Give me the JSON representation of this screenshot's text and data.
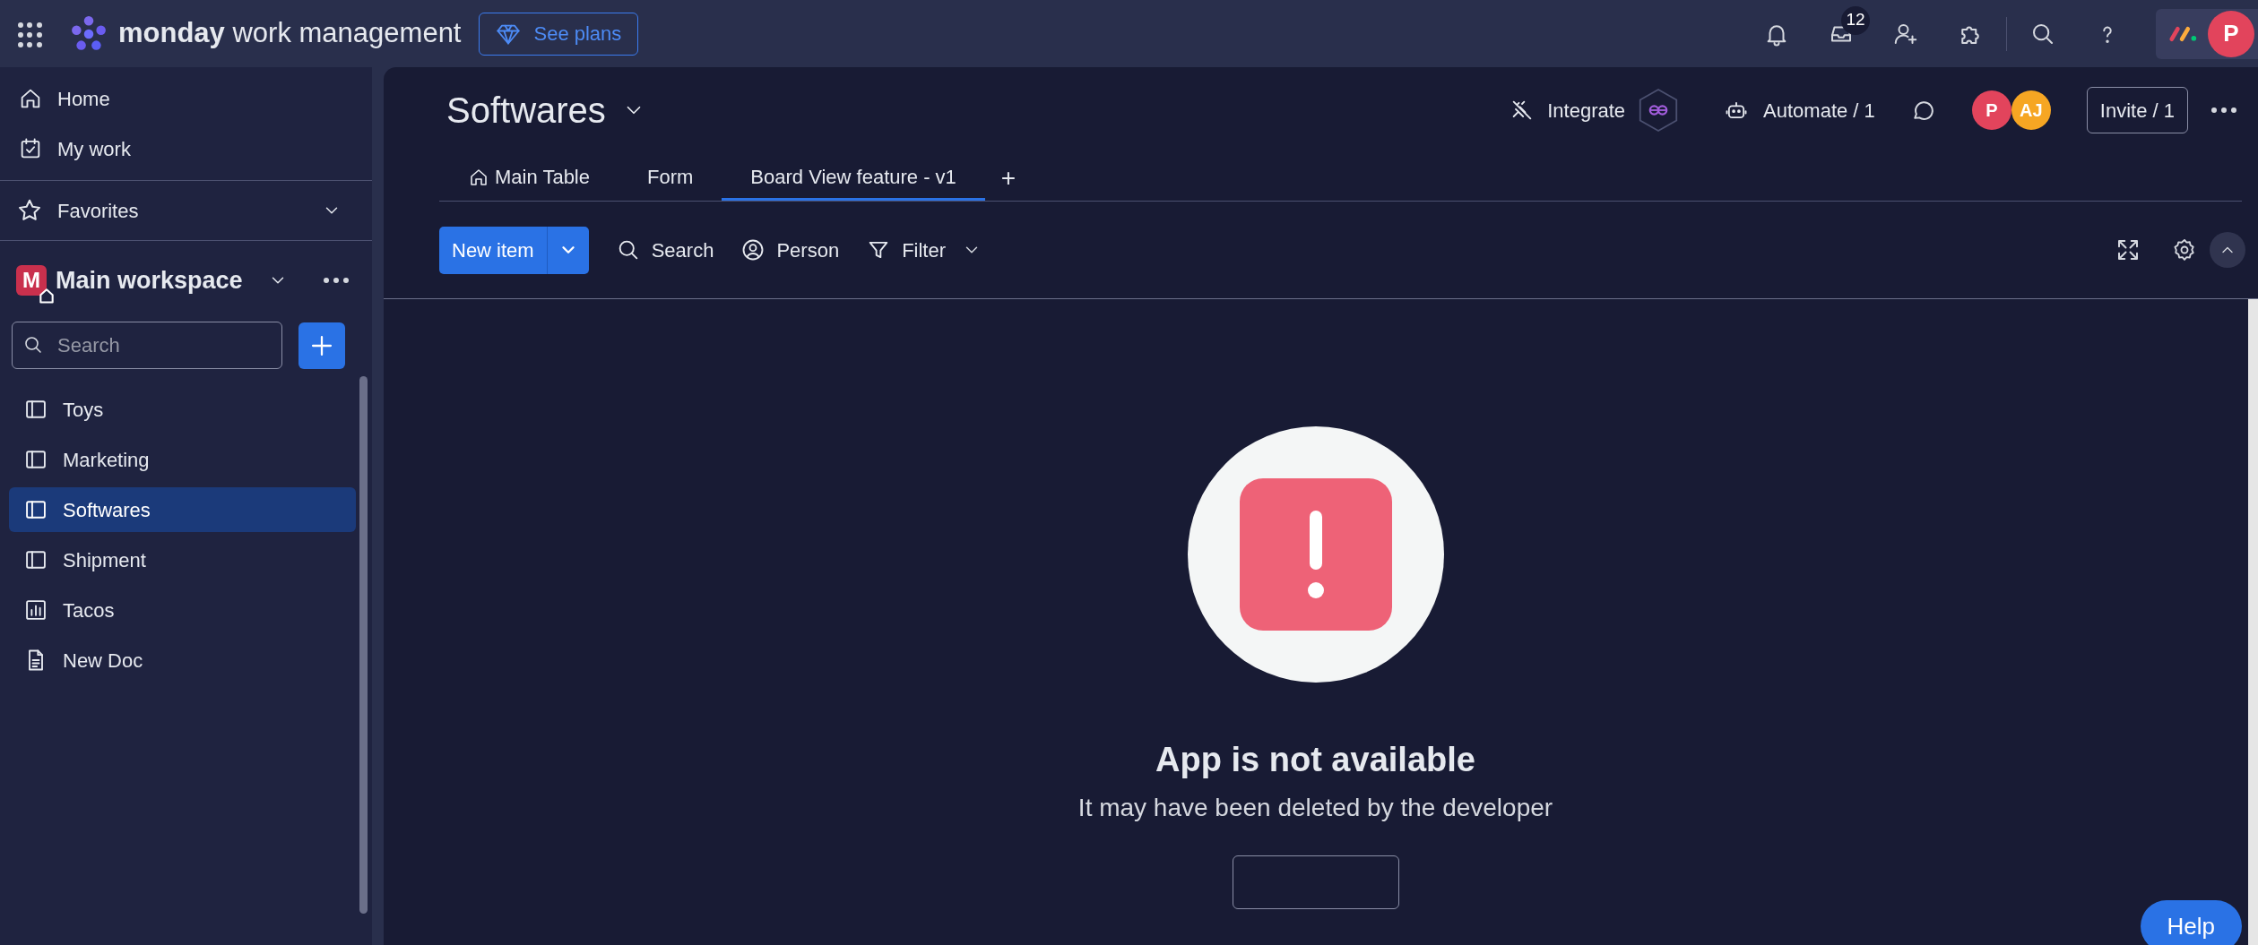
{
  "top_bar": {
    "brand_bold": "monday",
    "brand_rest": "work management",
    "plans_button": "See plans",
    "inbox_badge": "12",
    "avatar": "P"
  },
  "sidebar": {
    "nav": [
      {
        "label": "Home",
        "kind": "home"
      },
      {
        "label": "My work",
        "kind": "mywork"
      }
    ],
    "favorites": "Favorites",
    "workspace": {
      "badge": "M",
      "name": "Main workspace"
    },
    "search": {
      "placeholder": "Search"
    },
    "items": [
      {
        "label": "Toys",
        "kind": "board",
        "selected": false
      },
      {
        "label": "Marketing",
        "kind": "board",
        "selected": false
      },
      {
        "label": "Softwares",
        "kind": "board",
        "selected": true
      },
      {
        "label": "Shipment",
        "kind": "board",
        "selected": false
      },
      {
        "label": "Tacos",
        "kind": "dashboard",
        "selected": false
      },
      {
        "label": "New Doc",
        "kind": "doc",
        "selected": false
      }
    ]
  },
  "board": {
    "title": "Softwares",
    "integrate": "Integrate",
    "automate": "Automate / 1",
    "members": [
      {
        "initials": "P",
        "color": "#e2445c"
      },
      {
        "initials": "AJ",
        "color": "#f6a623"
      }
    ],
    "invite": "Invite / 1",
    "tabs": [
      {
        "label": "Main Table",
        "kind": "table",
        "selected": false
      },
      {
        "label": "Form",
        "kind": "plain",
        "selected": false
      },
      {
        "label": "Board View feature - v1",
        "kind": "plain",
        "selected": true
      }
    ],
    "add_tab": "+",
    "toolbar": {
      "new_item": "New item",
      "search": "Search",
      "person": "Person",
      "filter": "Filter"
    }
  },
  "empty_state": {
    "title": "App is not available",
    "message": "It may have been deleted by the developer"
  },
  "help_button": "Help"
}
